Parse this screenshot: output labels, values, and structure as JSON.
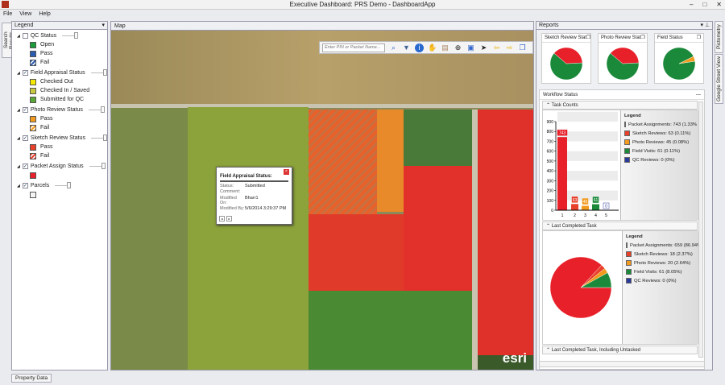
{
  "window": {
    "title": "Executive Dashboard: PRS Demo - DashboardApp"
  },
  "menu": [
    "File",
    "View",
    "Help"
  ],
  "side_tabs": {
    "left": "Search Results",
    "right": [
      "Pictometry",
      "Google Street View"
    ],
    "bottom": "Property Data"
  },
  "legend": {
    "title": "Legend",
    "groups": [
      {
        "label": "QC Status",
        "checked": false,
        "items": [
          {
            "label": "Open",
            "color": "#1a9a3a"
          },
          {
            "label": "Pass",
            "color": "#2a5db0"
          },
          {
            "label": "Fail",
            "color": "#2a5db0",
            "hatch": true
          }
        ]
      },
      {
        "label": "Field Appraisal Status",
        "checked": true,
        "items": [
          {
            "label": "Checked Out",
            "color": "#f5e800"
          },
          {
            "label": "Checked In / Saved",
            "color": "#c8c840"
          },
          {
            "label": "Submitted for QC",
            "color": "#5aa83a"
          }
        ]
      },
      {
        "label": "Photo Review Status",
        "checked": true,
        "items": [
          {
            "label": "Pass",
            "color": "#f29a1e"
          },
          {
            "label": "Fail",
            "color": "#f29a1e",
            "hatch": true
          }
        ]
      },
      {
        "label": "Sketch Review Status",
        "checked": true,
        "items": [
          {
            "label": "Pass",
            "color": "#e8402a"
          },
          {
            "label": "Fail",
            "color": "#e8402a",
            "hatch": true
          }
        ]
      },
      {
        "label": "Packet Assign Status",
        "checked": true,
        "items": [
          {
            "label": "",
            "color": "#e8202a"
          }
        ]
      },
      {
        "label": "Parcels",
        "checked": true,
        "items": [
          {
            "label": "",
            "color": "#f4f4f4"
          }
        ]
      }
    ]
  },
  "map": {
    "tab": "Map",
    "search_placeholder": "Enter PIN or Packet Name...",
    "watermark": "esri",
    "popup": {
      "title": "Field Appraisal Status:",
      "rows": [
        {
          "k": "Status:",
          "v": "Submitted"
        },
        {
          "k": "Comment:",
          "v": ""
        },
        {
          "k": "Modified On:",
          "v": "Bharr1"
        },
        {
          "k": "Modified By:",
          "v": "5/6/2014 3:29:37 PM"
        }
      ]
    }
  },
  "reports": {
    "title": "Reports",
    "cards": [
      {
        "title": "Sketch Review Stat"
      },
      {
        "title": "Photo Review Stat"
      },
      {
        "title": "Field Status"
      }
    ],
    "workflow_title": "Workflow Status",
    "sections": [
      "Task Counts",
      "Last Completed Task",
      "Last Completed Task, Including Untasked"
    ]
  },
  "chart_data": [
    {
      "type": "bar",
      "title": "Task Counts",
      "categories": [
        "1",
        "2",
        "3",
        "4",
        "5"
      ],
      "values": [
        743,
        63,
        45,
        61,
        0
      ],
      "colors": [
        "#e8202a",
        "#e8402a",
        "#f29a1e",
        "#1a8a3a",
        "#2a3a9a"
      ],
      "ylim": [
        0,
        900
      ],
      "yticks": [
        "0",
        "100",
        "200",
        "300",
        "400",
        "500",
        "600",
        "700",
        "800",
        "900"
      ],
      "legend_title": "Legend",
      "legend": [
        "Packet Assignments: 743 (1.33%",
        "Sketch Reviews: 63 (0.11%)",
        "Photo Reviews: 45 (0.08%)",
        "Field Visits: 61 (0.11%)",
        "QC Reviews: 0 (0%)"
      ]
    },
    {
      "type": "pie",
      "title": "Last Completed Task",
      "values": [
        659,
        18,
        20,
        61,
        0
      ],
      "colors": [
        "#e8202a",
        "#e8402a",
        "#f29a1e",
        "#1a8a3a",
        "#2a3a9a"
      ],
      "legend_title": "Legend",
      "legend": [
        "Packet Assignments: 659 (86.94%",
        "Sketch Reviews: 18 (2.37%)",
        "Photo Reviews: 20 (2.64%)",
        "Field Visits: 61 (8.05%)",
        "QC Reviews: 0 (0%)"
      ]
    },
    {
      "type": "pie",
      "title": "Sketch Review Stat",
      "values": [
        62,
        38
      ],
      "colors": [
        "#1a8a3a",
        "#e8202a"
      ]
    },
    {
      "type": "pie",
      "title": "Photo Review Stat",
      "values": [
        62,
        38
      ],
      "colors": [
        "#1a8a3a",
        "#e8202a"
      ]
    },
    {
      "type": "pie",
      "title": "Field Status",
      "values": [
        95,
        5
      ],
      "colors": [
        "#1a8a3a",
        "#f29a1e"
      ]
    }
  ]
}
